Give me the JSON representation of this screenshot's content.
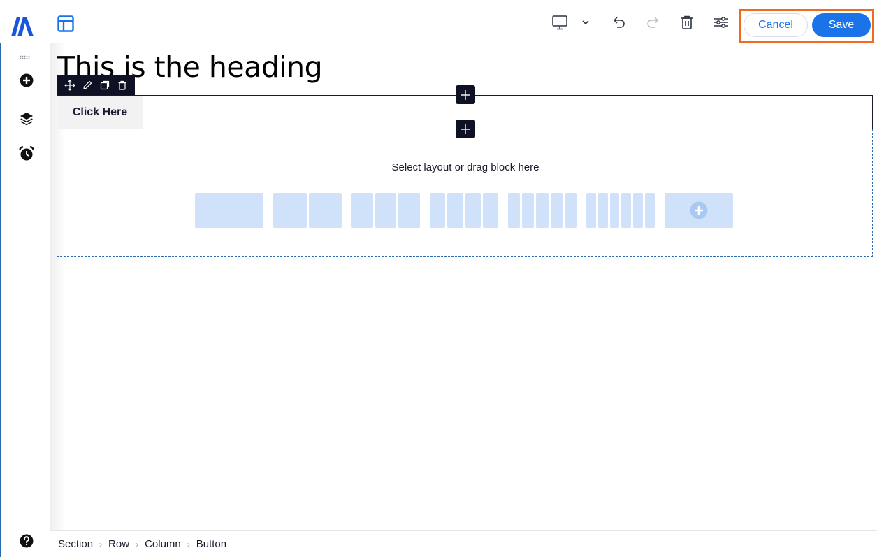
{
  "icons": {
    "logo": "brand-logo-icon",
    "layout": "layout-icon",
    "device": "desktop-icon",
    "device_menu": "chevron-down-icon",
    "undo": "undo-icon",
    "redo": "redo-icon",
    "delete": "trash-icon",
    "settings": "sliders-icon",
    "rail": [
      "drag-grip-icon",
      "add-circle-icon",
      "layers-icon",
      "alarm-clock-icon",
      "help-icon"
    ],
    "element_toolbar": [
      "move-icon",
      "pencil-icon",
      "duplicate-icon",
      "delete-icon"
    ]
  },
  "colors": {
    "accent": "#1a73e8",
    "highlight": "#f26a1b",
    "toolbar_dark": "#0f1225",
    "layout_placeholder": "#cfe2fa"
  },
  "header": {
    "cancel_label": "Cancel",
    "save_label": "Save"
  },
  "canvas": {
    "heading": "This is the heading",
    "button_label": "Click Here",
    "dropzone_text": "Select layout or drag block here",
    "layout_options": [
      {
        "name": "layout-1-col",
        "columns": 1
      },
      {
        "name": "layout-2-col",
        "columns": 2
      },
      {
        "name": "layout-3-col",
        "columns": 3
      },
      {
        "name": "layout-4-col",
        "columns": 4
      },
      {
        "name": "layout-5-col",
        "columns": 5
      },
      {
        "name": "layout-6-col",
        "columns": 6
      },
      {
        "name": "layout-custom-add",
        "columns": 0
      }
    ]
  },
  "breadcrumb": [
    "Section",
    "Row",
    "Column",
    "Button"
  ]
}
